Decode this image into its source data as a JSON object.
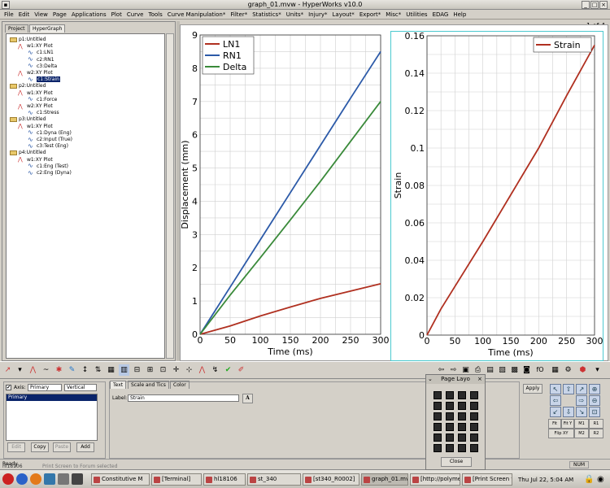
{
  "window": {
    "title": "graph_01.mvw - HyperWorks v10.0",
    "page_indicator": "1 of 4"
  },
  "menu": [
    "File",
    "Edit",
    "View",
    "Page",
    "Applications",
    "Plot",
    "Curve",
    "Tools",
    "Curve Manipulation*",
    "Filter*",
    "Statistics*",
    "Units*",
    "Injury*",
    "Layout*",
    "Export*",
    "Misc*",
    "Utilities",
    "EDAG",
    "Help"
  ],
  "panel_tabs": [
    "Project",
    "HyperGraph"
  ],
  "tree": [
    {
      "label": "p1:Untitled",
      "type": "page"
    },
    {
      "label": "w1:XY Plot",
      "type": "window"
    },
    {
      "label": "c1:LN1",
      "type": "curve"
    },
    {
      "label": "c2:RN1",
      "type": "curve"
    },
    {
      "label": "c3:Delta",
      "type": "curve"
    },
    {
      "label": "w2:XY Plot",
      "type": "window"
    },
    {
      "label": "c1:Strain",
      "type": "curve",
      "selected": true
    },
    {
      "label": "p2:Untitled",
      "type": "page"
    },
    {
      "label": "w1:XY Plot",
      "type": "window"
    },
    {
      "label": "c1:Force",
      "type": "curve"
    },
    {
      "label": "w2:XY Plot",
      "type": "window"
    },
    {
      "label": "c1:Stress",
      "type": "curve"
    },
    {
      "label": "p3:Untitled",
      "type": "page"
    },
    {
      "label": "w1:XY Plot",
      "type": "window"
    },
    {
      "label": "c1:Dyna (Eng)",
      "type": "curve"
    },
    {
      "label": "c2:Input (True)",
      "type": "curve"
    },
    {
      "label": "c3:Test (Eng)",
      "type": "curve"
    },
    {
      "label": "p4:Untitled",
      "type": "page"
    },
    {
      "label": "w1:XY Plot",
      "type": "window"
    },
    {
      "label": "c1:Eng (Test)",
      "type": "curve"
    },
    {
      "label": "c2:Eng (Dyna)",
      "type": "curve"
    }
  ],
  "chart_data": [
    {
      "type": "line",
      "xlabel": "Time (ms)",
      "ylabel": "Displacement (mm)",
      "xlim": [
        0,
        300
      ],
      "ylim": [
        0,
        9
      ],
      "xticks": [
        0,
        50,
        100,
        150,
        200,
        250,
        300
      ],
      "yticks": [
        0,
        1,
        2,
        3,
        4,
        5,
        6,
        7,
        8,
        9
      ],
      "grid": true,
      "legend": "top-left",
      "series": [
        {
          "name": "LN1",
          "color": "#b03020",
          "x": [
            0,
            50,
            100,
            150,
            200,
            250,
            300
          ],
          "y": [
            0,
            0.25,
            0.55,
            0.82,
            1.08,
            1.3,
            1.52
          ]
        },
        {
          "name": "RN1",
          "color": "#2c5aa8",
          "x": [
            0,
            50,
            100,
            150,
            200,
            250,
            300
          ],
          "y": [
            0,
            1.42,
            2.84,
            4.26,
            5.68,
            7.1,
            8.5
          ]
        },
        {
          "name": "Delta",
          "color": "#3a8a3a",
          "x": [
            0,
            50,
            100,
            150,
            200,
            250,
            300
          ],
          "y": [
            0,
            1.18,
            2.3,
            3.44,
            4.6,
            5.8,
            7.0
          ]
        }
      ]
    },
    {
      "type": "line",
      "xlabel": "Time (ms)",
      "ylabel": "Strain",
      "xlim": [
        0,
        300
      ],
      "ylim": [
        0,
        0.16
      ],
      "xticks": [
        0,
        50,
        100,
        150,
        200,
        250,
        300
      ],
      "yticks": [
        0,
        0.02,
        0.04,
        0.06,
        0.08,
        0.1,
        0.12,
        0.14,
        0.16
      ],
      "grid": true,
      "legend": "top-right",
      "series": [
        {
          "name": "Strain",
          "color": "#b03020",
          "x": [
            0,
            25,
            50,
            100,
            150,
            200,
            250,
            300
          ],
          "y": [
            0,
            0.014,
            0.026,
            0.05,
            0.075,
            0.1,
            0.128,
            0.155
          ]
        }
      ]
    }
  ],
  "panel": {
    "axis_label": "Axis:",
    "axis_value": "Primary",
    "orientation": "Vertical",
    "axis_list": [
      "Primary"
    ],
    "tabs": [
      "Text",
      "Scale and Tics",
      "Color"
    ],
    "label_caption": "Label:",
    "label_value": "Strain",
    "buttons": [
      "Edit",
      "Copy",
      "Paste",
      "Add"
    ],
    "apply": "Apply"
  },
  "page_layout": {
    "title": "Page Layo",
    "close": "Close"
  },
  "nav_buttons": [
    "Fit",
    "Fit Y",
    "M1",
    "R1",
    "Flip XY",
    "M2",
    "R2"
  ],
  "status": {
    "left": "Ready",
    "right": "NUM",
    "hint": "hl18106",
    "hint2": "Print Screen to Forum   selected"
  },
  "taskbar": {
    "tasks": [
      "Constitutive M",
      "[Terminal]",
      "hl18106",
      "st_340",
      "[st340_R0002]",
      "graph_01.mvw",
      "[http://polymer",
      "[Print Screen t"
    ],
    "clock": "Thu Jul 22,  5:04 AM"
  }
}
